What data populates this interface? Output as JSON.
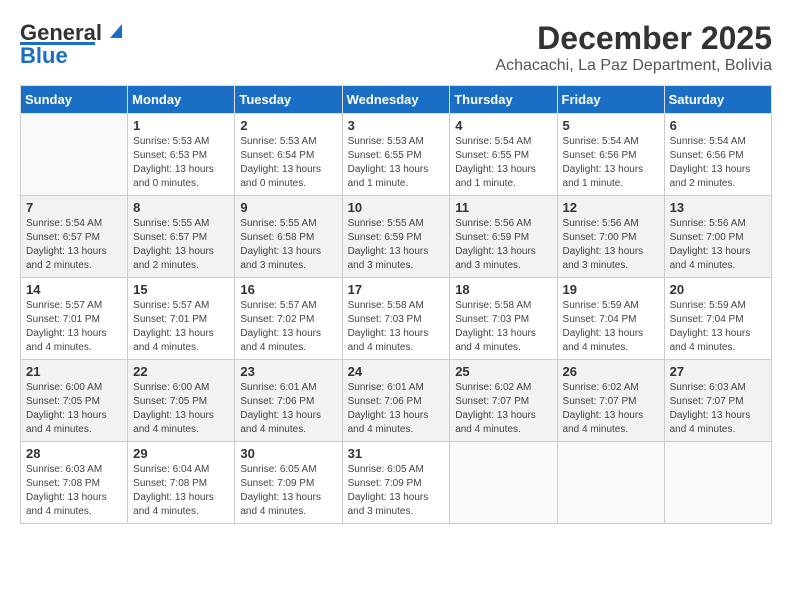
{
  "header": {
    "logo_general": "General",
    "logo_blue": "Blue",
    "month_title": "December 2025",
    "subtitle": "Achacachi, La Paz Department, Bolivia"
  },
  "weekdays": [
    "Sunday",
    "Monday",
    "Tuesday",
    "Wednesday",
    "Thursday",
    "Friday",
    "Saturday"
  ],
  "weeks": [
    [
      {
        "day": "",
        "info": ""
      },
      {
        "day": "1",
        "info": "Sunrise: 5:53 AM\nSunset: 6:53 PM\nDaylight: 13 hours\nand 0 minutes."
      },
      {
        "day": "2",
        "info": "Sunrise: 5:53 AM\nSunset: 6:54 PM\nDaylight: 13 hours\nand 0 minutes."
      },
      {
        "day": "3",
        "info": "Sunrise: 5:53 AM\nSunset: 6:55 PM\nDaylight: 13 hours\nand 1 minute."
      },
      {
        "day": "4",
        "info": "Sunrise: 5:54 AM\nSunset: 6:55 PM\nDaylight: 13 hours\nand 1 minute."
      },
      {
        "day": "5",
        "info": "Sunrise: 5:54 AM\nSunset: 6:56 PM\nDaylight: 13 hours\nand 1 minute."
      },
      {
        "day": "6",
        "info": "Sunrise: 5:54 AM\nSunset: 6:56 PM\nDaylight: 13 hours\nand 2 minutes."
      }
    ],
    [
      {
        "day": "7",
        "info": "Sunrise: 5:54 AM\nSunset: 6:57 PM\nDaylight: 13 hours\nand 2 minutes."
      },
      {
        "day": "8",
        "info": "Sunrise: 5:55 AM\nSunset: 6:57 PM\nDaylight: 13 hours\nand 2 minutes."
      },
      {
        "day": "9",
        "info": "Sunrise: 5:55 AM\nSunset: 6:58 PM\nDaylight: 13 hours\nand 3 minutes."
      },
      {
        "day": "10",
        "info": "Sunrise: 5:55 AM\nSunset: 6:59 PM\nDaylight: 13 hours\nand 3 minutes."
      },
      {
        "day": "11",
        "info": "Sunrise: 5:56 AM\nSunset: 6:59 PM\nDaylight: 13 hours\nand 3 minutes."
      },
      {
        "day": "12",
        "info": "Sunrise: 5:56 AM\nSunset: 7:00 PM\nDaylight: 13 hours\nand 3 minutes."
      },
      {
        "day": "13",
        "info": "Sunrise: 5:56 AM\nSunset: 7:00 PM\nDaylight: 13 hours\nand 4 minutes."
      }
    ],
    [
      {
        "day": "14",
        "info": "Sunrise: 5:57 AM\nSunset: 7:01 PM\nDaylight: 13 hours\nand 4 minutes."
      },
      {
        "day": "15",
        "info": "Sunrise: 5:57 AM\nSunset: 7:01 PM\nDaylight: 13 hours\nand 4 minutes."
      },
      {
        "day": "16",
        "info": "Sunrise: 5:57 AM\nSunset: 7:02 PM\nDaylight: 13 hours\nand 4 minutes."
      },
      {
        "day": "17",
        "info": "Sunrise: 5:58 AM\nSunset: 7:03 PM\nDaylight: 13 hours\nand 4 minutes."
      },
      {
        "day": "18",
        "info": "Sunrise: 5:58 AM\nSunset: 7:03 PM\nDaylight: 13 hours\nand 4 minutes."
      },
      {
        "day": "19",
        "info": "Sunrise: 5:59 AM\nSunset: 7:04 PM\nDaylight: 13 hours\nand 4 minutes."
      },
      {
        "day": "20",
        "info": "Sunrise: 5:59 AM\nSunset: 7:04 PM\nDaylight: 13 hours\nand 4 minutes."
      }
    ],
    [
      {
        "day": "21",
        "info": "Sunrise: 6:00 AM\nSunset: 7:05 PM\nDaylight: 13 hours\nand 4 minutes."
      },
      {
        "day": "22",
        "info": "Sunrise: 6:00 AM\nSunset: 7:05 PM\nDaylight: 13 hours\nand 4 minutes."
      },
      {
        "day": "23",
        "info": "Sunrise: 6:01 AM\nSunset: 7:06 PM\nDaylight: 13 hours\nand 4 minutes."
      },
      {
        "day": "24",
        "info": "Sunrise: 6:01 AM\nSunset: 7:06 PM\nDaylight: 13 hours\nand 4 minutes."
      },
      {
        "day": "25",
        "info": "Sunrise: 6:02 AM\nSunset: 7:07 PM\nDaylight: 13 hours\nand 4 minutes."
      },
      {
        "day": "26",
        "info": "Sunrise: 6:02 AM\nSunset: 7:07 PM\nDaylight: 13 hours\nand 4 minutes."
      },
      {
        "day": "27",
        "info": "Sunrise: 6:03 AM\nSunset: 7:07 PM\nDaylight: 13 hours\nand 4 minutes."
      }
    ],
    [
      {
        "day": "28",
        "info": "Sunrise: 6:03 AM\nSunset: 7:08 PM\nDaylight: 13 hours\nand 4 minutes."
      },
      {
        "day": "29",
        "info": "Sunrise: 6:04 AM\nSunset: 7:08 PM\nDaylight: 13 hours\nand 4 minutes."
      },
      {
        "day": "30",
        "info": "Sunrise: 6:05 AM\nSunset: 7:09 PM\nDaylight: 13 hours\nand 4 minutes."
      },
      {
        "day": "31",
        "info": "Sunrise: 6:05 AM\nSunset: 7:09 PM\nDaylight: 13 hours\nand 3 minutes."
      },
      {
        "day": "",
        "info": ""
      },
      {
        "day": "",
        "info": ""
      },
      {
        "day": "",
        "info": ""
      }
    ]
  ]
}
